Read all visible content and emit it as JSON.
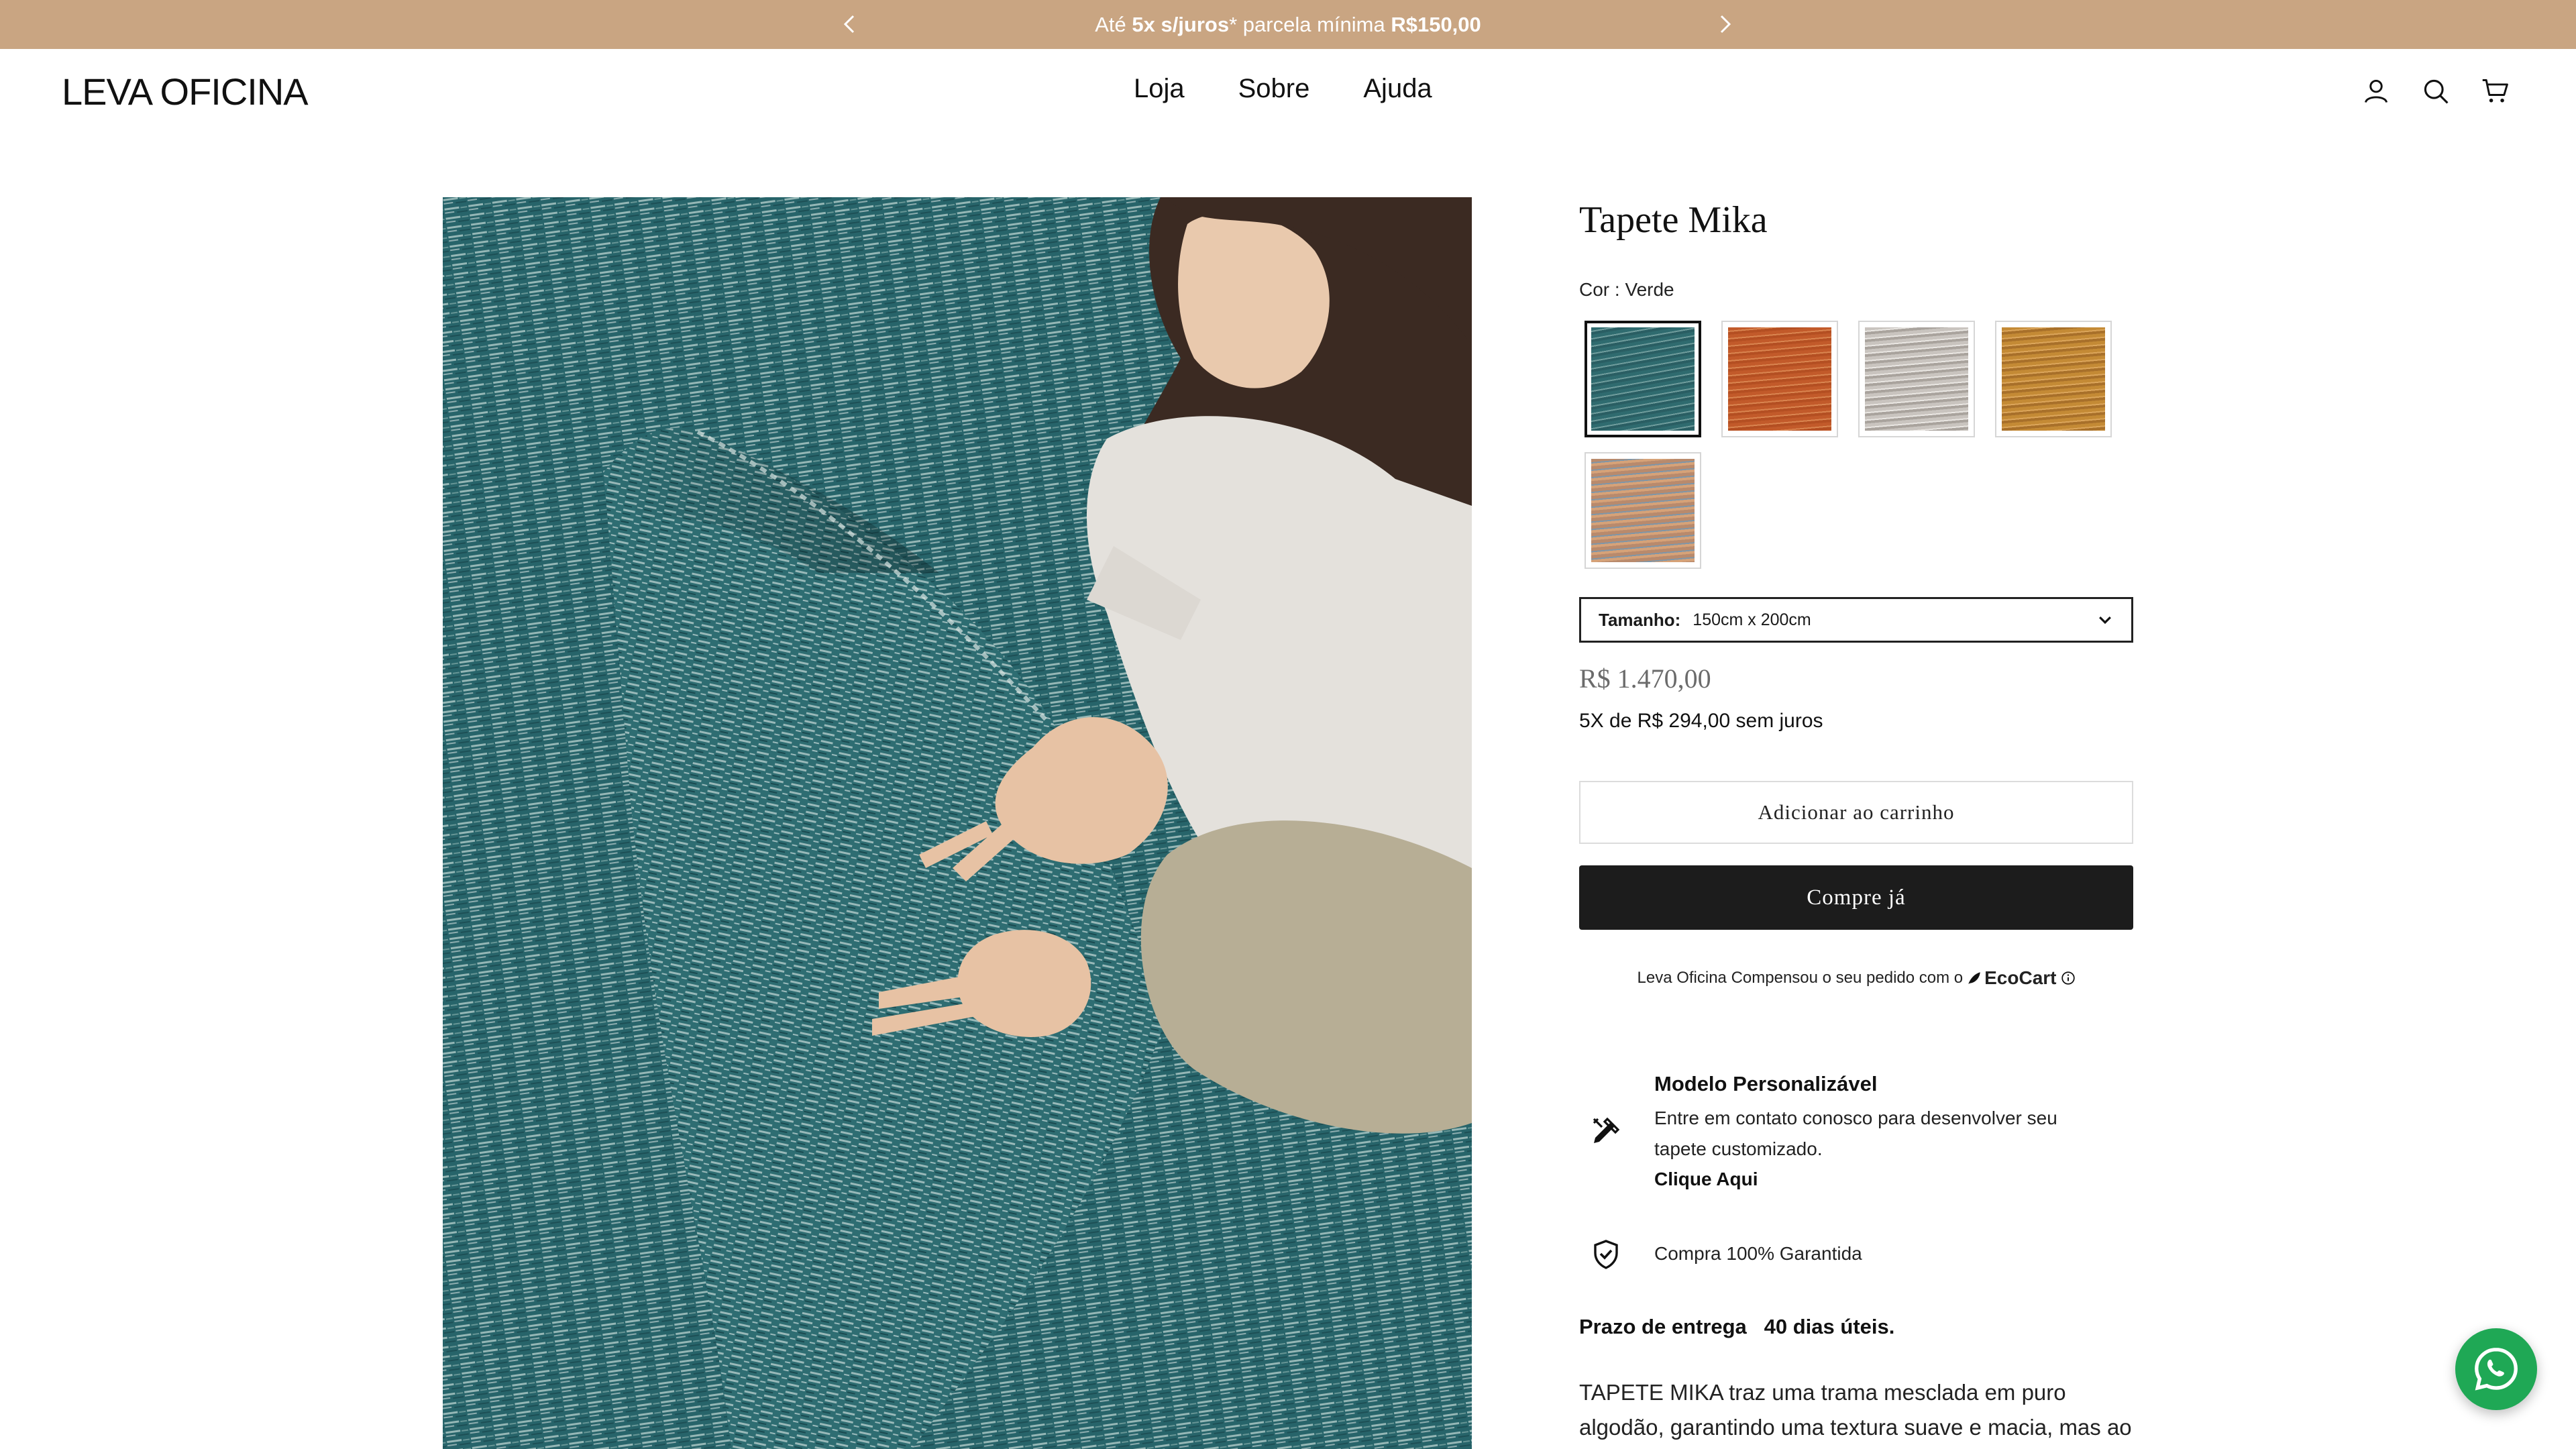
{
  "announcement": {
    "prefix": "Até ",
    "bold1": "5x s/juros",
    "middle": "* parcela mínima ",
    "bold2": "R$150,00"
  },
  "header": {
    "logo": "LEVA OFICINA",
    "nav": [
      "Loja",
      "Sobre",
      "Ajuda"
    ]
  },
  "product": {
    "title": "Tapete Mika",
    "color_label": "Cor : Verde",
    "swatches": [
      {
        "name": "verde",
        "color": "#2f6b6f",
        "selected": true
      },
      {
        "name": "terracota",
        "color": "#c25a2a",
        "selected": false
      },
      {
        "name": "cinza",
        "color": "#c9c4bf",
        "selected": false
      },
      {
        "name": "mostarda",
        "color": "#c48a35",
        "selected": false
      },
      {
        "name": "mesclado",
        "color": "#b98a6c",
        "selected": false
      }
    ],
    "size_label": "Tamanho:",
    "size_value": "150cm x 200cm",
    "price": "R$ 1.470,00",
    "installments": "5X de R$ 294,00 sem juros",
    "add_to_cart": "Adicionar ao carrinho",
    "buy_now": "Compre já",
    "eco_text": "Leva Oficina Compensou o seu pedido com o",
    "eco_brand": "EcoCart",
    "feature1": {
      "title": "Modelo Personalizável",
      "text": "Entre em contato conosco para desenvolver seu tapete customizado.",
      "link": "Clique Aqui"
    },
    "feature2": {
      "title": "Compra 100% Garantida"
    },
    "delivery_label": "Prazo de entrega",
    "delivery_value": "40 dias úteis.",
    "description": "TAPETE MIKA traz uma trama mesclada em puro algodão, garantindo uma textura suave e macia, mas ao"
  },
  "icons": {
    "prev": "chevron-left-icon",
    "next": "chevron-right-icon",
    "account": "user-icon",
    "search": "search-icon",
    "cart": "cart-icon",
    "dropdown": "chevron-down-icon",
    "customize": "pencil-ruler-icon",
    "guarantee": "shield-check-icon",
    "whatsapp": "whatsapp-icon"
  },
  "colors": {
    "announcement_bg": "#c9a582",
    "buy_button_bg": "#1c1c1c",
    "whatsapp_green": "#1fa855"
  }
}
